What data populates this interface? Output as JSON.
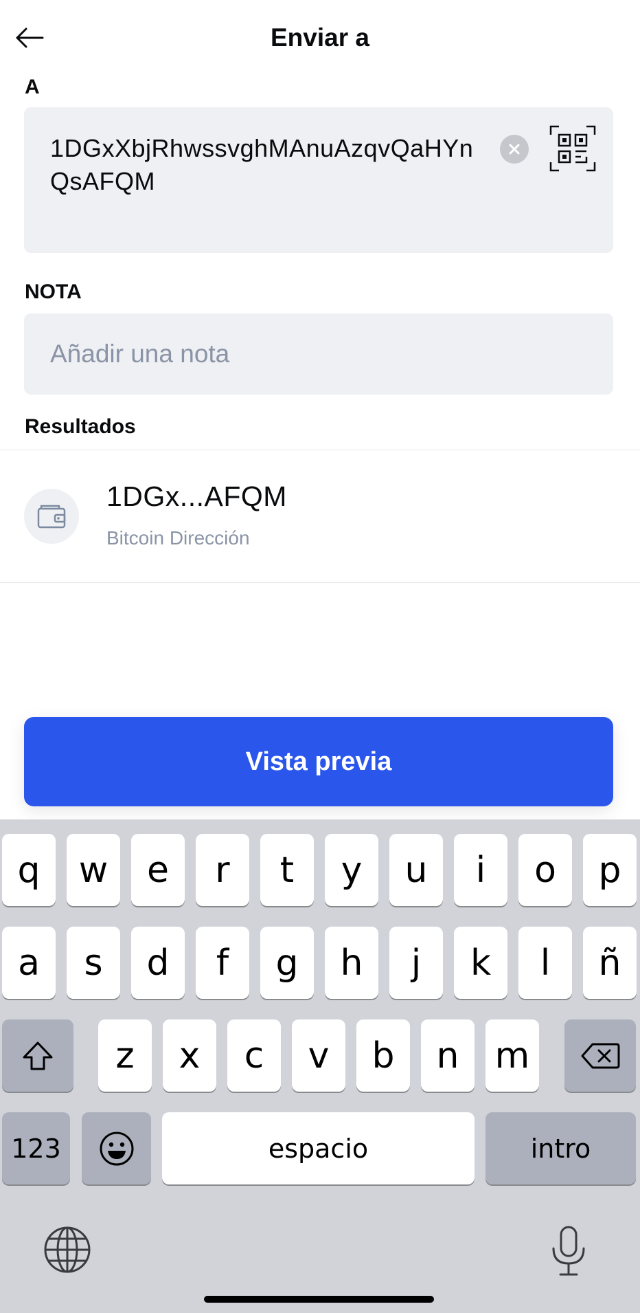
{
  "header": {
    "title": "Enviar a",
    "back_icon": "arrow-left-icon"
  },
  "to": {
    "label": "A",
    "address": "1DGxXbjRhwssvghMAnuAzqvQaHYnQsAFQM",
    "clear_icon": "clear-circle-icon",
    "qr_icon": "qr-scan-icon"
  },
  "note": {
    "label": "NOTA",
    "placeholder": "Añadir una nota",
    "value": ""
  },
  "results": {
    "label": "Resultados",
    "items": [
      {
        "title": "1DGx...AFQM",
        "subtitle": "Bitcoin Dirección",
        "icon": "wallet-icon"
      }
    ]
  },
  "preview_button": {
    "label": "Vista previa",
    "color": "#2b56eb"
  },
  "keyboard": {
    "row1": [
      "q",
      "w",
      "e",
      "r",
      "t",
      "y",
      "u",
      "i",
      "o",
      "p"
    ],
    "row2": [
      "a",
      "s",
      "d",
      "f",
      "g",
      "h",
      "j",
      "k",
      "l",
      "ñ"
    ],
    "row3": [
      "z",
      "x",
      "c",
      "v",
      "b",
      "n",
      "m"
    ],
    "numbers_label": "123",
    "space_label": "espacio",
    "return_label": "intro",
    "shift_icon": "shift-icon",
    "delete_icon": "backspace-icon",
    "emoji_icon": "emoji-icon",
    "globe_icon": "globe-icon",
    "mic_icon": "microphone-icon"
  }
}
